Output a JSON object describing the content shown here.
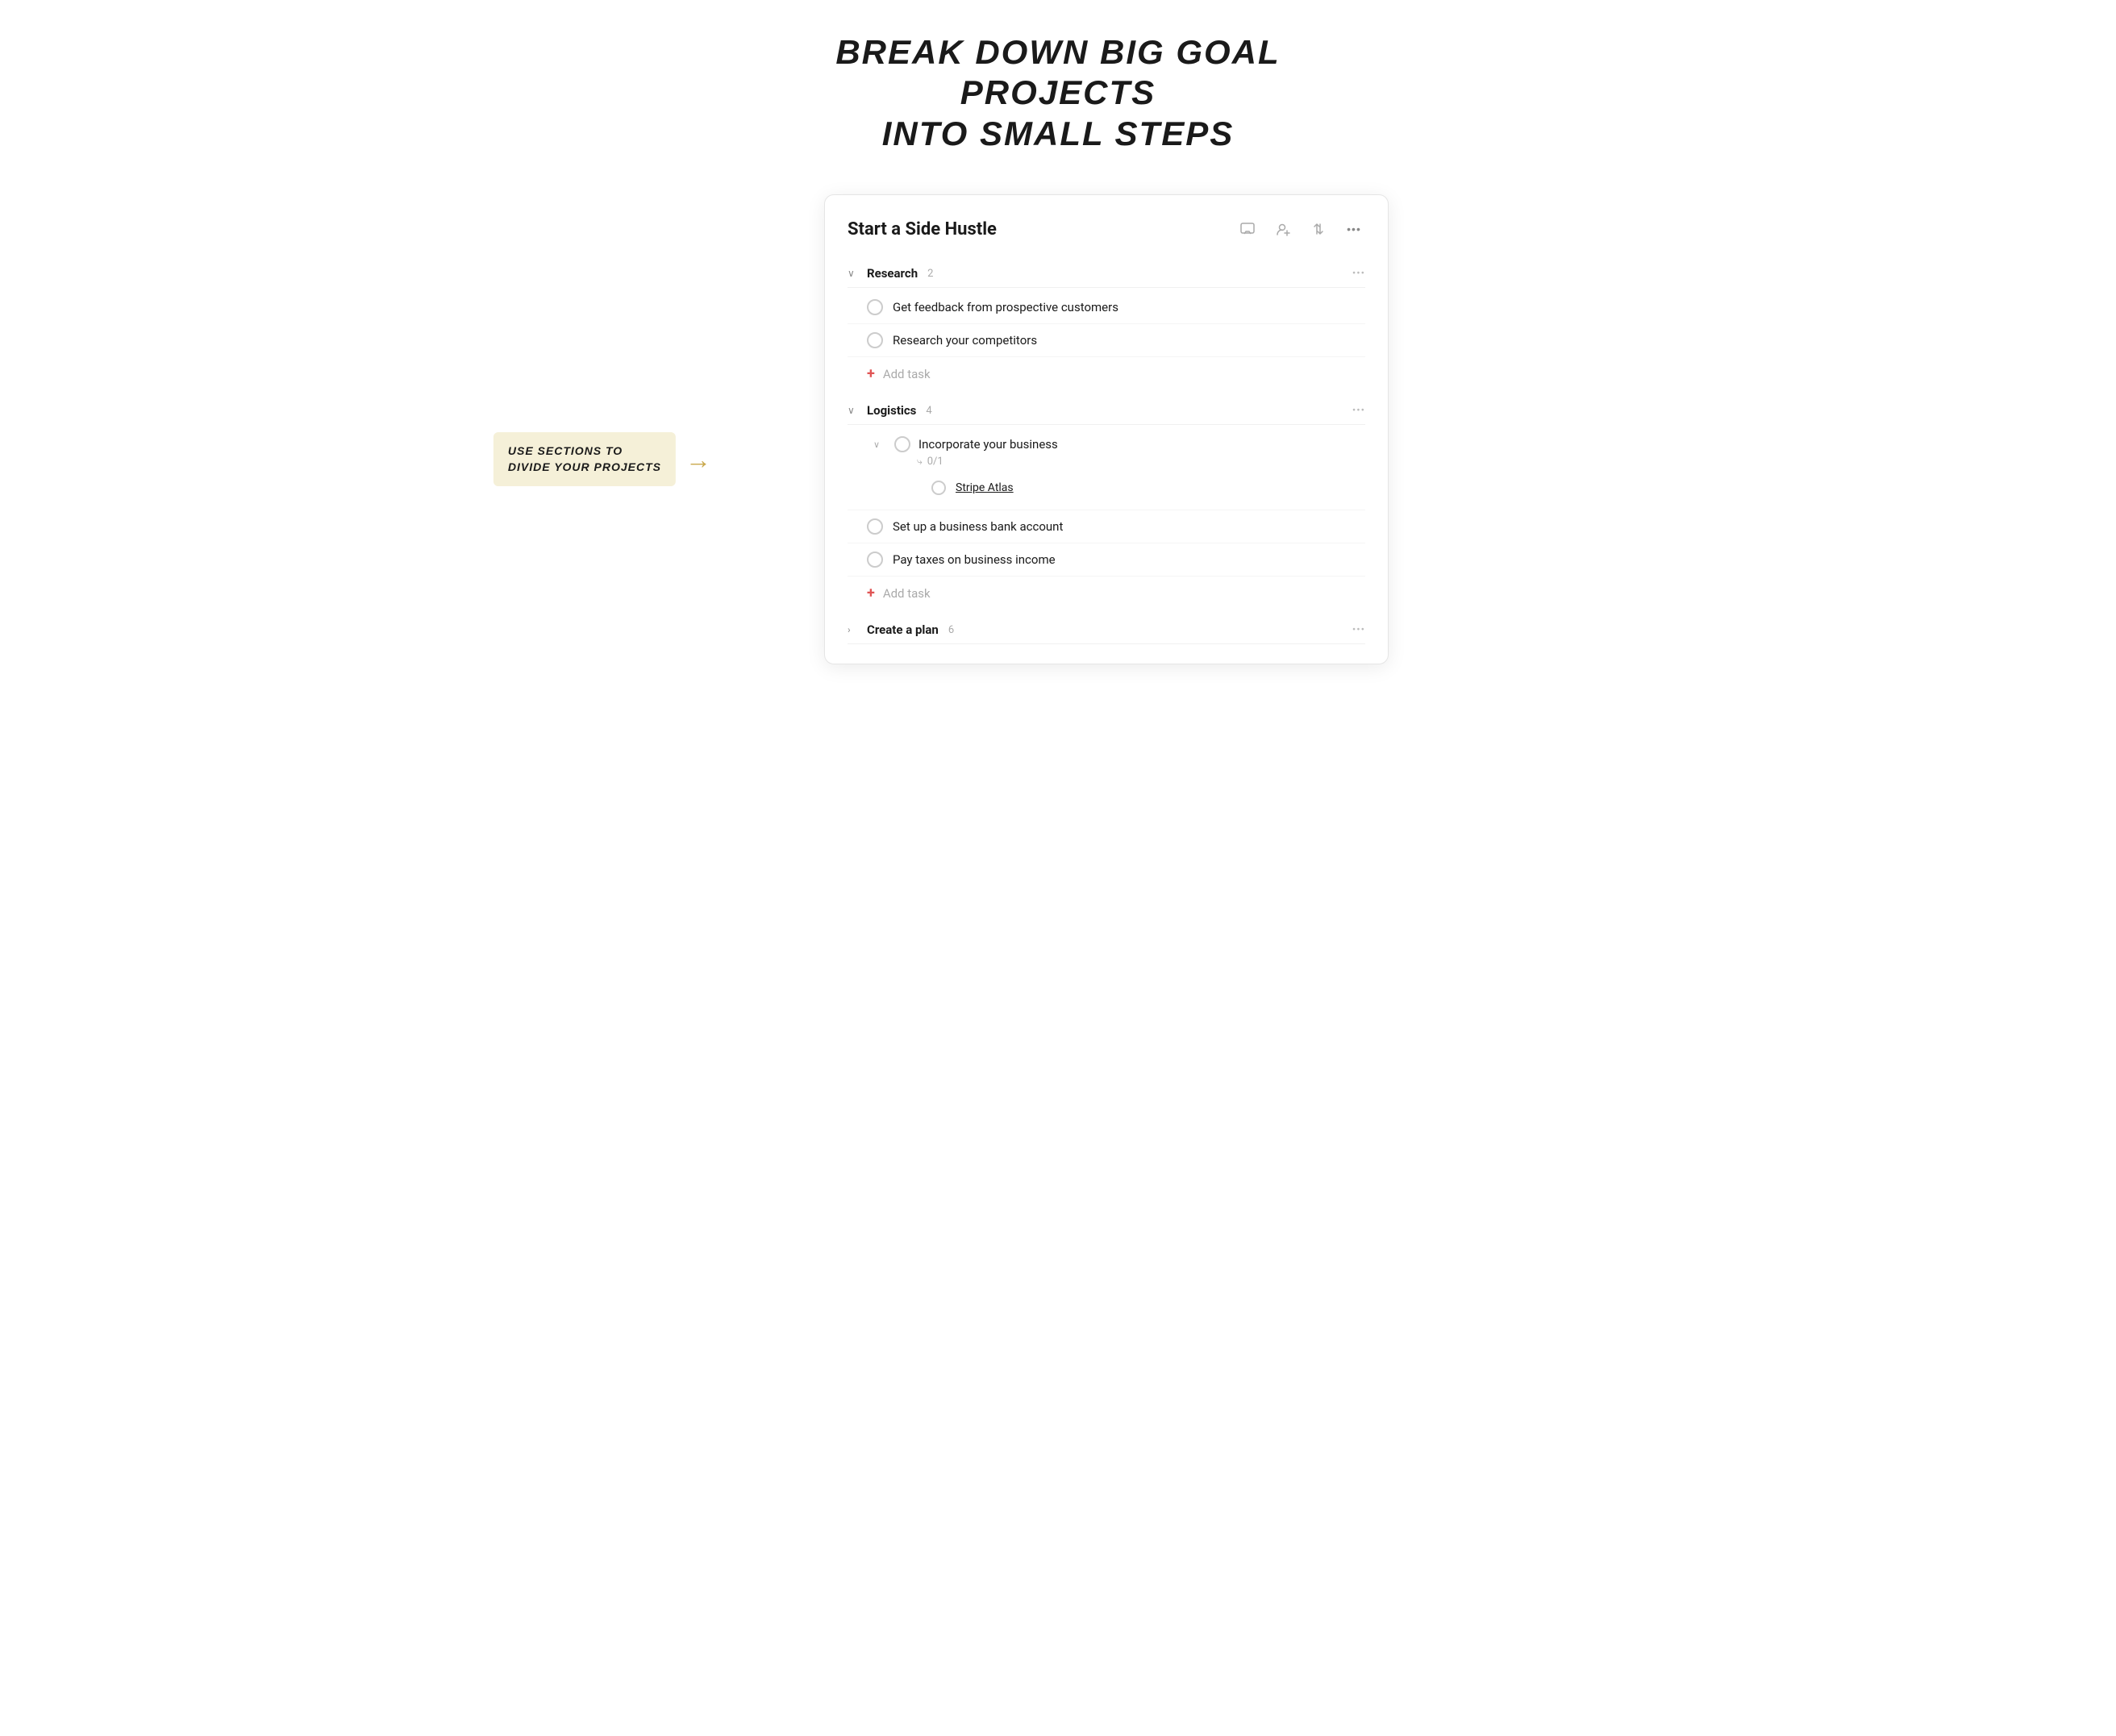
{
  "page": {
    "headline_line1": "Break Down Big Goal Projects",
    "headline_line2": "Into Small Steps"
  },
  "annotation": {
    "line1": "Use Sections To",
    "line2": "Divide Your Projects"
  },
  "panel": {
    "title": "Start a Side Hustle",
    "actions": {
      "comment_label": "Comment",
      "assign_label": "Assign",
      "sort_label": "Sort",
      "more_label": "More options"
    }
  },
  "sections": [
    {
      "id": "research",
      "name": "Research",
      "count": 2,
      "expanded": true,
      "tasks": [
        {
          "id": "t1",
          "text": "Get feedback from prospective customers",
          "done": false
        },
        {
          "id": "t2",
          "text": "Research your competitors",
          "done": false
        }
      ],
      "add_task_label": "Add task"
    },
    {
      "id": "logistics",
      "name": "Logistics",
      "count": 4,
      "expanded": true,
      "tasks": [
        {
          "id": "t3",
          "text": "Incorporate your business",
          "done": false,
          "has_subtasks": true,
          "subtask_count": "0/1",
          "subtasks": [
            {
              "id": "st1",
              "text": "Stripe Atlas",
              "done": false
            }
          ]
        },
        {
          "id": "t4",
          "text": "Set up a business bank account",
          "done": false
        },
        {
          "id": "t5",
          "text": "Pay taxes on business income",
          "done": false
        }
      ],
      "add_task_label": "Add task"
    },
    {
      "id": "create-a-plan",
      "name": "Create a plan",
      "count": 6,
      "expanded": false
    }
  ],
  "icons": {
    "comment": "💬",
    "assign": "👤",
    "sort": "↕",
    "more": "•••",
    "chevron_down": "∨",
    "chevron_right": ">",
    "subtask": "⤷",
    "plus": "+"
  }
}
